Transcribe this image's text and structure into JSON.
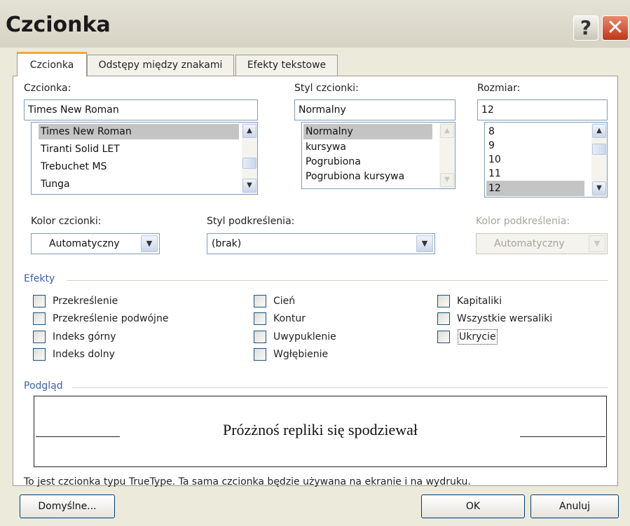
{
  "window": {
    "title": "Czcionka",
    "help_glyph": "?",
    "close_glyph": "✕"
  },
  "tabs": [
    {
      "label": "Czcionka",
      "active": true
    },
    {
      "label": "Odstępy między znakami",
      "active": false
    },
    {
      "label": "Efekty tekstowe",
      "active": false
    }
  ],
  "font": {
    "label": "Czcionka:",
    "value": "Times New Roman",
    "list": [
      "Times New Roman",
      "Tiranti Solid LET",
      "Trebuchet MS",
      "Tunga"
    ],
    "selected": "Times New Roman"
  },
  "style": {
    "label": "Styl czcionki:",
    "value": "Normalny",
    "list": [
      "Normalny",
      "kursywa",
      "Pogrubiona",
      "Pogrubiona kursywa"
    ],
    "selected": "Normalny"
  },
  "size": {
    "label": "Rozmiar:",
    "value": "12",
    "list": [
      "8",
      "9",
      "10",
      "11",
      "12"
    ],
    "selected": "12"
  },
  "font_color": {
    "label": "Kolor czcionki:",
    "value": "Automatyczny"
  },
  "underline_style": {
    "label": "Styl podkreślenia:",
    "value": "(brak)"
  },
  "underline_color": {
    "label": "Kolor podkreślenia:",
    "value": "Automatyczny",
    "disabled": true
  },
  "effects": {
    "title": "Efekty",
    "col1": [
      {
        "label": "Przekreślenie",
        "checked": false
      },
      {
        "label": "Przekreślenie podwójne",
        "checked": false
      },
      {
        "label": "Indeks górny",
        "checked": false
      },
      {
        "label": "Indeks dolny",
        "checked": false
      }
    ],
    "col2": [
      {
        "label": "Cień",
        "checked": false
      },
      {
        "label": "Kontur",
        "checked": false
      },
      {
        "label": "Uwypuklenie",
        "checked": false
      },
      {
        "label": "Wgłębienie",
        "checked": false
      }
    ],
    "col3": [
      {
        "label": "Kapitaliki",
        "checked": false
      },
      {
        "label": "Wszystkie wersaliki",
        "checked": false
      },
      {
        "label": "Ukrycie",
        "checked": false,
        "focused": true
      }
    ]
  },
  "preview": {
    "title": "Podgląd",
    "sample_text": "Prózżnoś repliki się spodziewał"
  },
  "info_text": "To jest czcionka typu TrueType. Ta sama czcionka będzie używana na ekranie i na wydruku.",
  "buttons": {
    "default": "Domyślne...",
    "ok": "OK",
    "cancel": "Anuluj"
  },
  "icons": {
    "scroll_up": "scroll-up-arrow-icon",
    "scroll_down": "scroll-down-arrow-icon",
    "dropdown": "chevron-down-icon"
  },
  "colors": {
    "dialog_bg": "#ECEADB",
    "tab_accent": "#F5A833",
    "section_title": "#3C5FB0",
    "close_button": "#C2351A"
  }
}
